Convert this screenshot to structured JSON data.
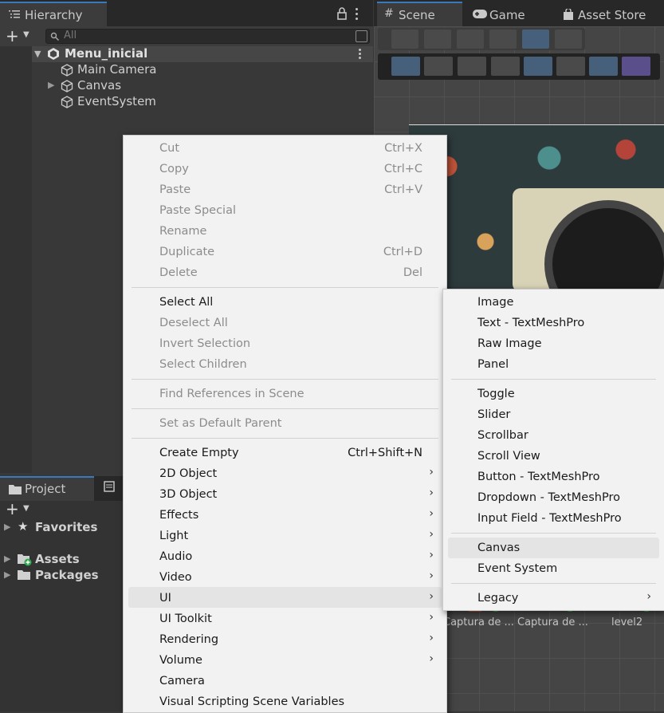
{
  "hierarchy": {
    "tab_label": "Hierarchy",
    "search_placeholder": "All",
    "scene_name": "Menu_inicial",
    "items": [
      "Main Camera",
      "Canvas",
      "EventSystem"
    ]
  },
  "project": {
    "tab_label": "Project",
    "items": [
      "Favorites",
      "Assets",
      "Packages"
    ]
  },
  "scene_view": {
    "tabs": [
      "Scene",
      "Game",
      "Asset Store"
    ],
    "assets_visible": [
      "Captura de ...",
      "Captura de ...",
      "level2"
    ]
  },
  "context_menu": {
    "groups": [
      [
        {
          "label": "Cut",
          "shortcut": "Ctrl+X",
          "enabled": false
        },
        {
          "label": "Copy",
          "shortcut": "Ctrl+C",
          "enabled": false
        },
        {
          "label": "Paste",
          "shortcut": "Ctrl+V",
          "enabled": false
        },
        {
          "label": "Paste Special",
          "shortcut": "",
          "enabled": false
        },
        {
          "label": "Rename",
          "shortcut": "",
          "enabled": false
        },
        {
          "label": "Duplicate",
          "shortcut": "Ctrl+D",
          "enabled": false
        },
        {
          "label": "Delete",
          "shortcut": "Del",
          "enabled": false
        }
      ],
      [
        {
          "label": "Select All",
          "enabled": true
        },
        {
          "label": "Deselect All",
          "enabled": false
        },
        {
          "label": "Invert Selection",
          "enabled": false
        },
        {
          "label": "Select Children",
          "enabled": false
        }
      ],
      [
        {
          "label": "Find References in Scene",
          "enabled": false
        }
      ],
      [
        {
          "label": "Set as Default Parent",
          "enabled": false
        }
      ],
      [
        {
          "label": "Create Empty",
          "shortcut": "Ctrl+Shift+N",
          "enabled": true
        },
        {
          "label": "2D Object",
          "submenu": true
        },
        {
          "label": "3D Object",
          "submenu": true
        },
        {
          "label": "Effects",
          "submenu": true
        },
        {
          "label": "Light",
          "submenu": true
        },
        {
          "label": "Audio",
          "submenu": true
        },
        {
          "label": "Video",
          "submenu": true
        },
        {
          "label": "UI",
          "submenu": true,
          "highlighted": true
        },
        {
          "label": "UI Toolkit",
          "submenu": true
        },
        {
          "label": "Rendering",
          "submenu": true
        },
        {
          "label": "Volume",
          "submenu": true
        },
        {
          "label": "Camera"
        },
        {
          "label": "Visual Scripting Scene Variables"
        }
      ]
    ]
  },
  "ui_submenu": {
    "groups": [
      [
        "Image",
        "Text - TextMeshPro",
        "Raw Image",
        "Panel"
      ],
      [
        "Toggle",
        "Slider",
        "Scrollbar",
        "Scroll View",
        "Button - TextMeshPro",
        "Dropdown - TextMeshPro",
        "Input Field - TextMeshPro"
      ],
      [
        "Canvas",
        "Event System"
      ],
      [
        "Legacy"
      ]
    ],
    "highlighted": "Canvas"
  }
}
